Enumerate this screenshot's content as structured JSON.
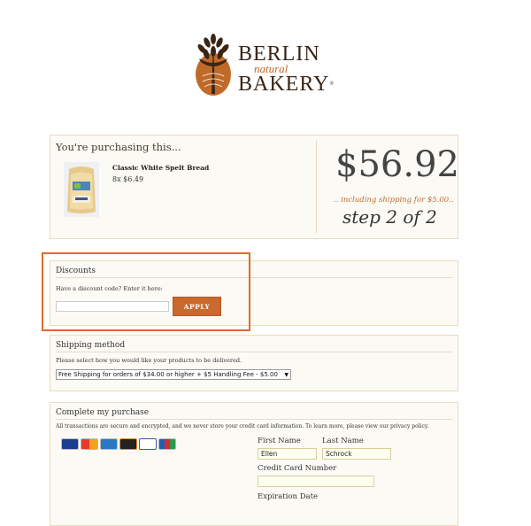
{
  "brand": {
    "line1": "BERLIN",
    "line2": "natural",
    "line3": "BAKERY",
    "reg": "®"
  },
  "purchase": {
    "title": "You're purchasing this...",
    "product_name": "Classic White Spelt Bread",
    "product_qty": "8x $6.49",
    "total": "$56.92",
    "shipping_note": ".. including shipping for $5.00..",
    "step": "step 2 of 2"
  },
  "discounts": {
    "title": "Discounts",
    "label": "Have a discount code? Enter it here:",
    "input_value": "",
    "apply_label": "APPLY"
  },
  "shipping": {
    "title": "Shipping method",
    "note": "Please select how you would like your products to be delivered.",
    "selected_option": "Free Shipping for orders of $34.00 or higher + $5 Handling Fee - $5.00"
  },
  "complete": {
    "title": "Complete my purchase",
    "note": "All transactions are secure and encrypted, and we never store your credit card information. To learn more, please view our privacy policy.",
    "cards": [
      "visa",
      "mastercard",
      "amex",
      "discover",
      "diners",
      "jcb"
    ],
    "first_name_label": "First Name",
    "last_name_label": "Last Name",
    "first_name_value": "Ellen",
    "last_name_value": "Schrock",
    "card_number_label": "Credit Card Number",
    "card_number_value": "",
    "expiration_label": "Expiration Date"
  },
  "colors": {
    "accent": "#c9692d",
    "highlight": "#e06a2a",
    "panel_bg": "#fbfaf5",
    "panel_border": "#e8dcc2"
  }
}
